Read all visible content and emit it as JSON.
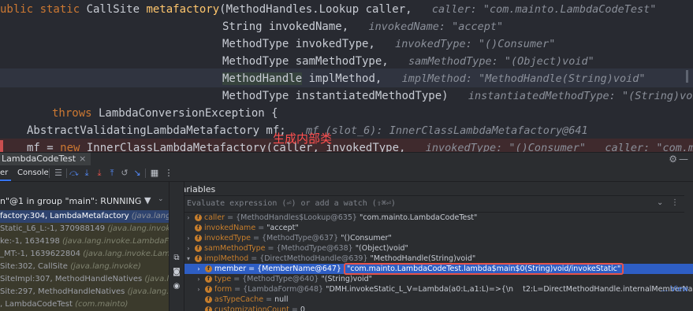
{
  "editor": {
    "line1": {
      "pre": "ublic static ",
      "type": "CallSite ",
      "fn": "metafactory",
      "rest": "(MethodHandles.Lookup caller,",
      "hint": "caller: \"com.mainto.LambdaCodeTest\""
    },
    "line2": {
      "code": "String invokedName,",
      "hint": "invokedName: \"accept\""
    },
    "line3": {
      "code": "MethodType invokedType,",
      "hint": "invokedType: \"()Consumer\""
    },
    "line4": {
      "code": "MethodType samMethodType,",
      "hint": "samMethodType: \"(Object)void\""
    },
    "line5": {
      "code_hl": "MethodHandle",
      "code": " implMethod,",
      "hint": "implMethod: \"MethodHandle(String)void\""
    },
    "line6": {
      "code": "MethodType instantiatedMethodType)",
      "hint": "instantiatedMethodType: \"(String)void\""
    },
    "line7": {
      "kw": "throws",
      "code": " LambdaConversionException {"
    },
    "line8": {
      "code": "AbstractValidatingLambdaMetafactory mf;",
      "hint": "mf (slot_6): InnerClassLambdaMetafactory@641"
    },
    "line9": {
      "pre": "mf = ",
      "kw": "new",
      "code": " InnerClassLambdaMetafactory(caller, invokedType,",
      "hint": "invokedType: \"()Consumer\"   caller: \"com.mainto"
    },
    "annotation": "生成内部类"
  },
  "debug_tab": {
    "label": "LambdaCodeTest",
    "close": "×"
  },
  "toolbar": {
    "tab_partial": "er",
    "console_label": "Console"
  },
  "frames": {
    "thread": "n\"@1 in group \"main\": RUNNING",
    "rows": [
      {
        "text": "factory:304, LambdaMetafactory ",
        "pkg": "(java.lang.invoke)",
        "style": "sel"
      },
      {
        "text": "Static_L6_L:-1, 370988149 ",
        "pkg": "(java.lang.invoke.LambdaForm$",
        "style": "lib"
      },
      {
        "text": "ke:-1, 1634198 ",
        "pkg": "(java.lang.invoke.LambdaForm$BMH",
        "style": "lib"
      },
      {
        "text": "_MT:-1, 1639622804 ",
        "pkg": "(java.lang.invoke.LambdaForm",
        "style": "lib"
      },
      {
        "text": "Site:302, CallSite ",
        "pkg": "(java.lang.invoke)",
        "style": "lib"
      },
      {
        "text": "SiteImpl:307, MethodHandleNatives ",
        "pkg": "(java.lang.invo",
        "style": "lib"
      },
      {
        "text": "Site:297, MethodHandleNatives ",
        "pkg": "(java.lang.invok",
        "style": "lib"
      },
      {
        "text": ", LambdaCodeTest ",
        "pkg": "(com.mainto)",
        "style": "lib"
      }
    ]
  },
  "variables": {
    "title": "Variables",
    "eval_placeholder": "Evaluate expression (⏎) or add a watch (⇧⌘⏎)",
    "rows": [
      {
        "name": "caller",
        "type": " = {MethodHandles$Lookup@635} ",
        "value": "\"com.mainto.LambdaCodeTest\"",
        "indent": 0
      },
      {
        "name": "invokedName",
        "type": " = ",
        "value": "\"accept\"",
        "indent": 0
      },
      {
        "name": "invokedType",
        "type": " = {MethodType@637} ",
        "value": "\"()Consumer\"",
        "indent": 0
      },
      {
        "name": "samMethodType",
        "type": " = {MethodType@638} ",
        "value": "\"(Object)void\"",
        "indent": 0
      },
      {
        "name": "implMethod",
        "type": " = {DirectMethodHandle@639} ",
        "value": "\"MethodHandle(String)void\"",
        "indent": 0
      },
      {
        "name": "member",
        "type": " = {MemberName@647} ",
        "value": "\"com.mainto.LambdaCodeTest.lambda$main$0(String)void/invokeStatic\"",
        "indent": 1
      },
      {
        "name": "type",
        "type": " = {MethodType@640} ",
        "value": "\"(String)void\"",
        "indent": 1
      },
      {
        "name": "form",
        "type": " = {LambdaForm@648} ",
        "value": "\"DMH.invokeStatic_L_V=Lambda(a0:L,a1:L)=>{\\n    t2:L=DirectMethodHandle.internalMemberName(a0:L);\\n",
        "link": "... View",
        "indent": 1
      },
      {
        "name": "asTypeCache",
        "type": " = ",
        "value": "null",
        "indent": 1
      },
      {
        "name": "customizationCount",
        "type": " = ",
        "value": "0",
        "indent": 1
      }
    ]
  },
  "colors": {
    "accent": "#3574f0",
    "highlight_box": "#e5534b",
    "selection": "#2e5ec4"
  }
}
